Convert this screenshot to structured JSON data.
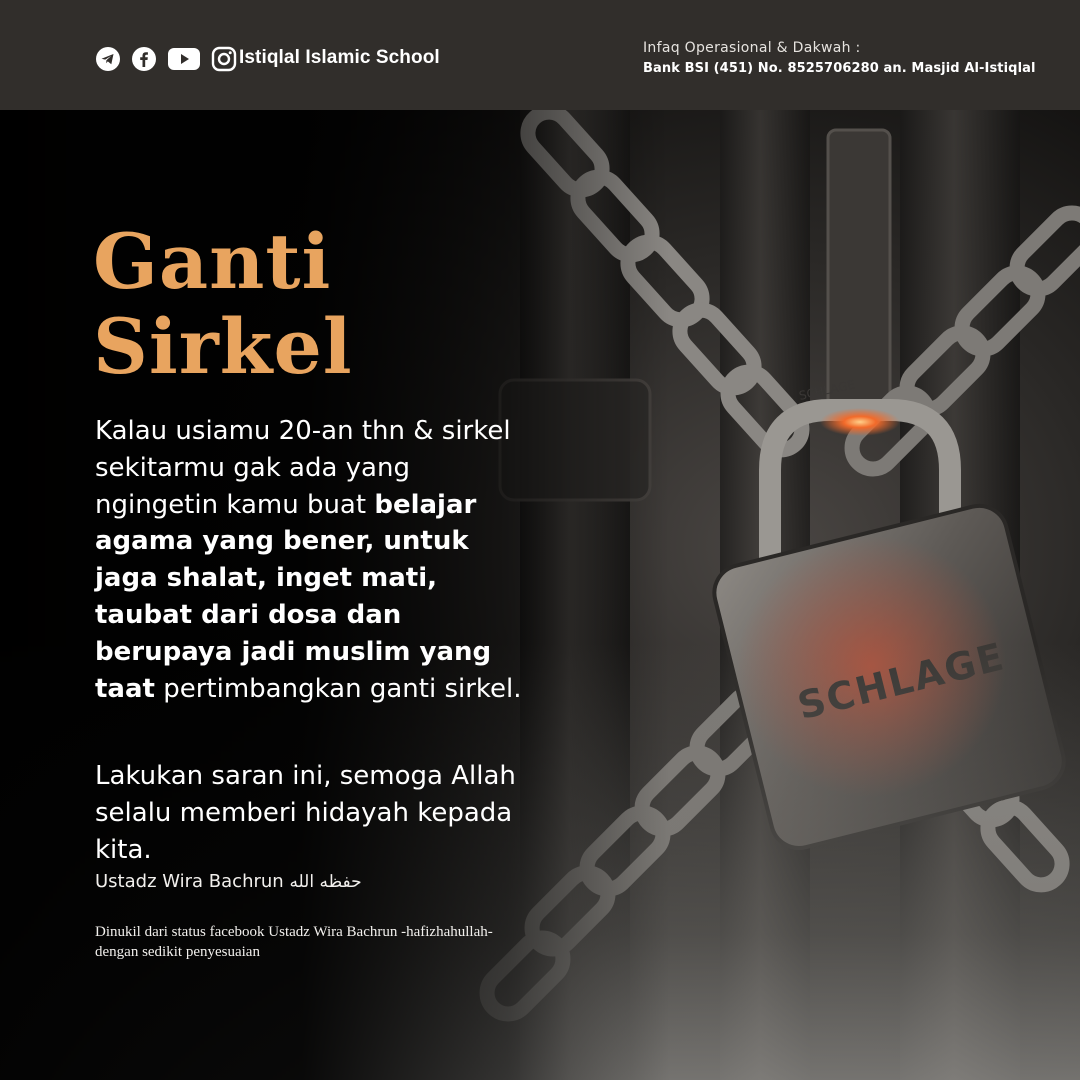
{
  "header": {
    "social_icons": [
      "telegram-icon",
      "facebook-icon",
      "youtube-icon",
      "instagram-icon"
    ],
    "brand": "Istiqlal Islamic School",
    "infaq_title": "Infaq Operasional & Dakwah :",
    "infaq_bank": "Bank BSI (451) No. 8525706280 an. Masjid Al-Istiqlal"
  },
  "photo": {
    "padlock_brand": "SCHLAGE",
    "shackle_text": "SCHLAGE"
  },
  "content": {
    "title_line1": "Ganti",
    "title_line2": "Sirkel",
    "para1_intro": "Kalau usiamu 20-an thn & sirkel sekitarmu gak ada yang ngingetin kamu buat ",
    "para1_bold": "belajar agama yang bener, untuk jaga shalat, inget mati, taubat dari dosa dan berupaya jadi muslim yang taat",
    "para1_end": " pertimbangkan ganti sirkel.",
    "para2": "Lakukan saran ini, semoga Allah selalu memberi hidayah kepada kita.",
    "author": "Ustadz Wira Bachrun",
    "author_honorific": "حفظه الله",
    "source": "Dinukil dari status facebook Ustadz Wira Bachrun -hafizhahullah- dengan sedikit penyesuaian"
  },
  "colors": {
    "header_bg": "#312e2b",
    "title": "#e8a45f",
    "text": "#ffffff"
  }
}
